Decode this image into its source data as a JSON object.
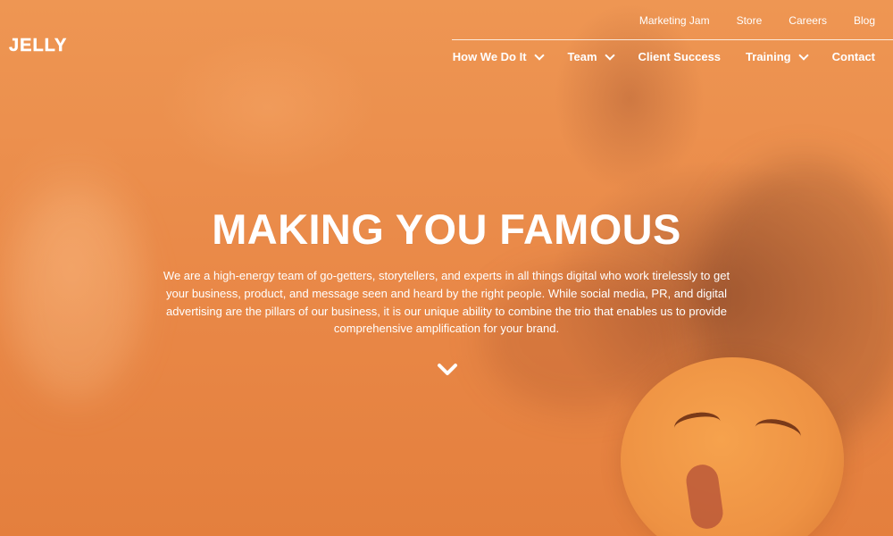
{
  "brand": {
    "logo_text": "JELLY"
  },
  "top_nav": {
    "links": [
      {
        "label": "Marketing Jam"
      },
      {
        "label": "Store"
      },
      {
        "label": "Careers"
      },
      {
        "label": "Blog"
      }
    ]
  },
  "main_nav": {
    "items": [
      {
        "label": "How We Do It"
      },
      {
        "label": "Team"
      },
      {
        "label": "Client Success"
      },
      {
        "label": "Training"
      },
      {
        "label": "Contact"
      }
    ]
  },
  "hero": {
    "title": "MAKING YOU FAMOUS",
    "description": "We are a high-energy team of go-getters, storytellers, and experts in all things digital who work tirelessly to get your business, product, and message seen and heard by the right people. While social media, PR, and digital advertising are the pillars of our business, it is our unique ability to combine the trio that enables us to provide comprehensive amplification for your brand."
  },
  "icons": {
    "dropdown": "chevron-down-icon",
    "scroll": "chevron-down-icon"
  },
  "colors": {
    "overlay": "#e98a45",
    "text": "#ffffff"
  }
}
